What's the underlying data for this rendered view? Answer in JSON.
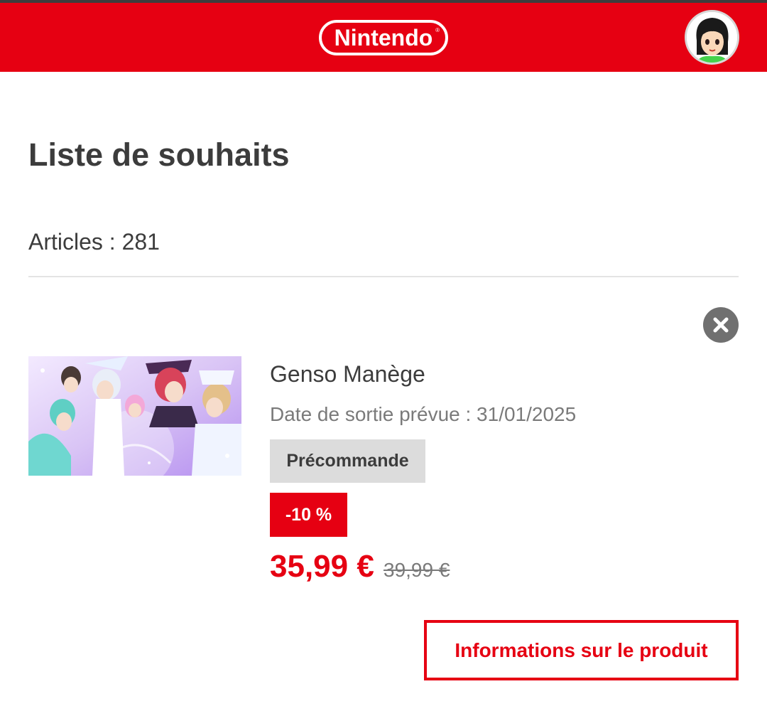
{
  "header": {
    "logo_text": "Nintendo",
    "logo_mark": "®",
    "brand_color": "#e60012",
    "avatar_icon": "user-avatar-icon"
  },
  "page": {
    "title": "Liste de souhaits",
    "item_count": "Articles : 281"
  },
  "wishlist_item": {
    "remove_icon": "close-icon",
    "thumbnail_icon": "game-artwork",
    "title": "Genso Manège",
    "release_date": "Date de sortie prévue : 31/01/2025",
    "status_badge": "Précommande",
    "discount_badge": "-10 %",
    "price_current": "35,99 €",
    "price_original": "39,99 €",
    "info_button": "Informations sur le produit"
  }
}
